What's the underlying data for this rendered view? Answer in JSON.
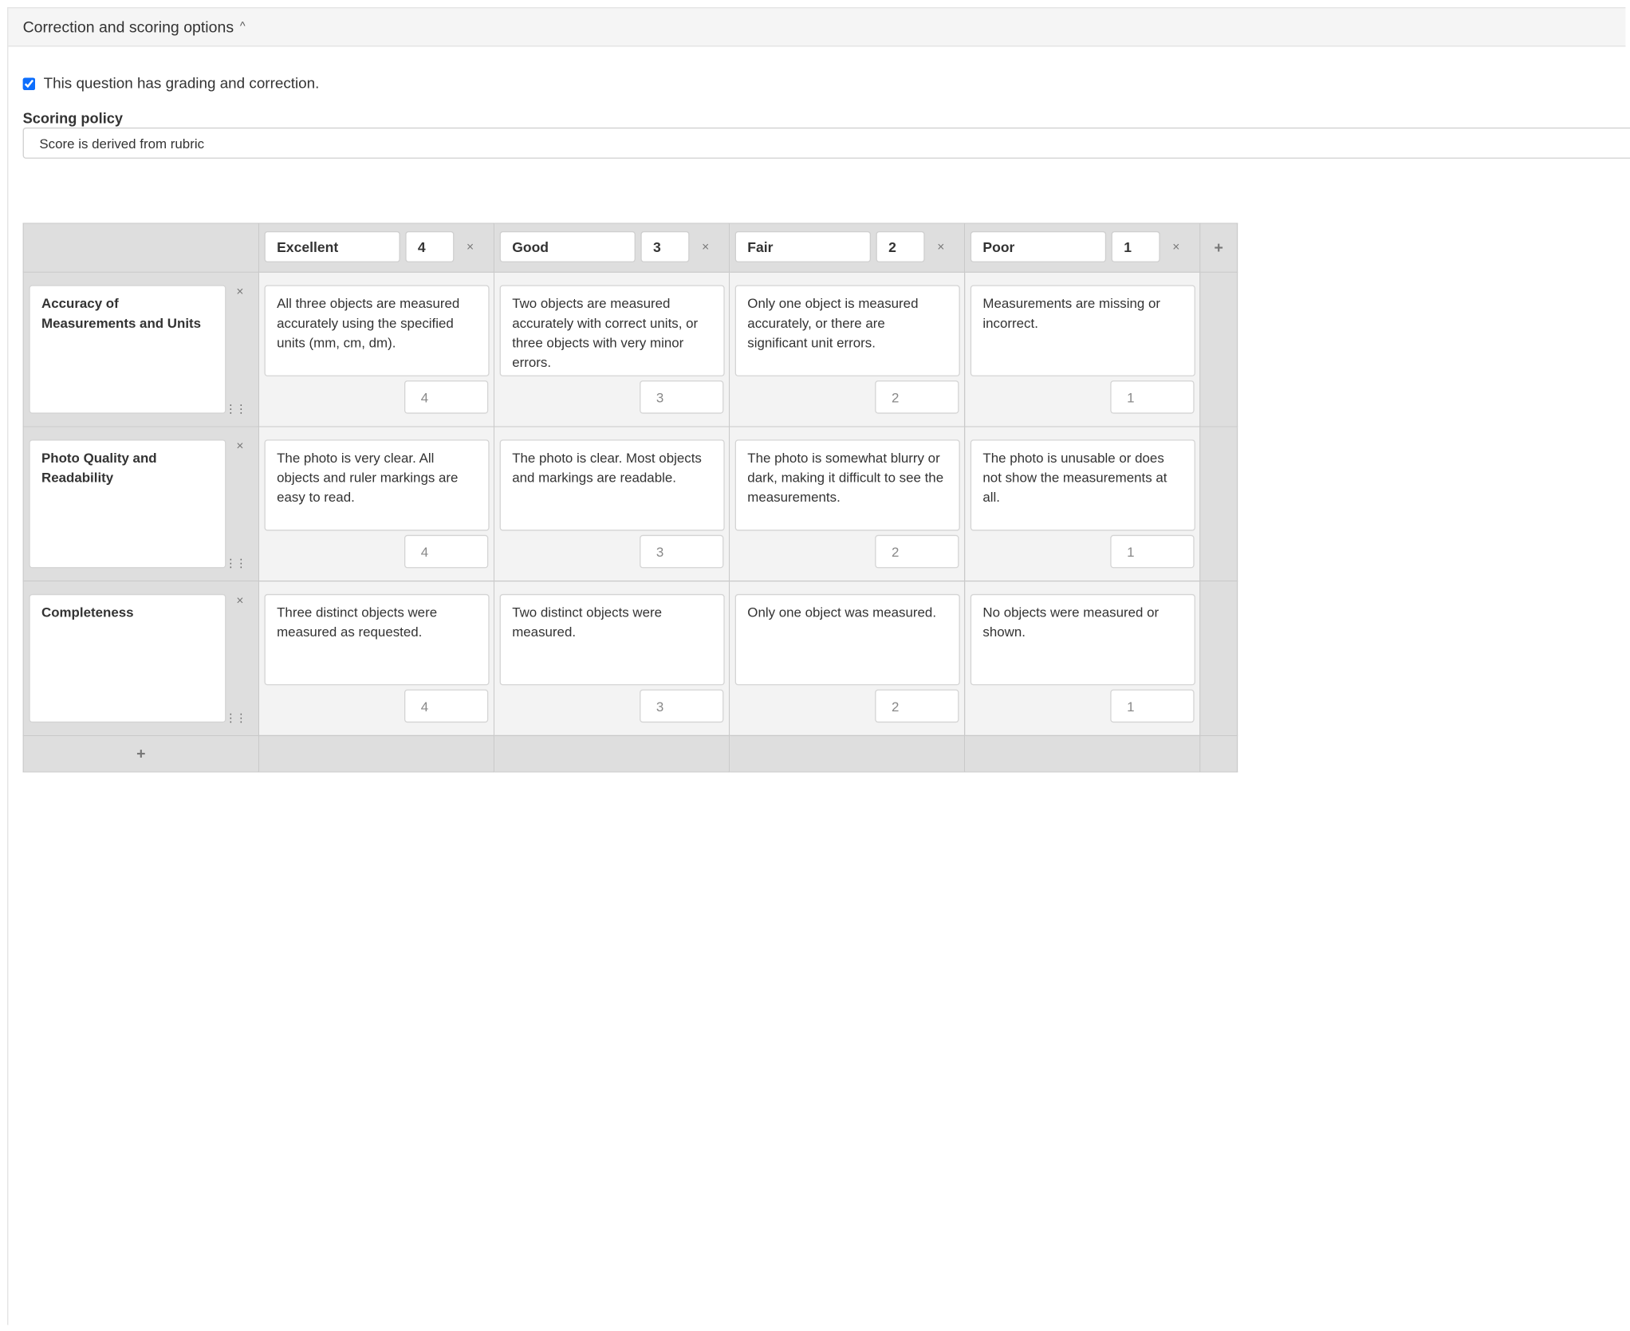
{
  "panel": {
    "title": "Correction and scoring options",
    "toggle_icon": "caret-up"
  },
  "grading": {
    "checkbox_label": "This question has grading and correction.",
    "checked": true
  },
  "scoring": {
    "label": "Scoring policy",
    "value": "Score is derived from rubric"
  },
  "rubric": {
    "levels": [
      {
        "name": "Excellent",
        "points": "4"
      },
      {
        "name": "Good",
        "points": "3"
      },
      {
        "name": "Fair",
        "points": "2"
      },
      {
        "name": "Poor",
        "points": "1"
      }
    ],
    "criteria": [
      {
        "name": "Accuracy of Measurements and Units",
        "cells": [
          {
            "text": "All three objects are measured accurately using the specified units (mm, cm, dm).",
            "points": "4"
          },
          {
            "text": "Two objects are measured accurately with correct units, or three objects with very minor errors.",
            "points": "3"
          },
          {
            "text": "Only one object is measured accurately, or there are significant unit errors.",
            "points": "2"
          },
          {
            "text": "Measurements are missing or incorrect.",
            "points": "1"
          }
        ]
      },
      {
        "name": "Photo Quality and Readability",
        "cells": [
          {
            "text": "The photo is very clear. All objects and ruler markings are easy to read.",
            "points": "4"
          },
          {
            "text": "The photo is clear. Most objects and markings are readable.",
            "points": "3"
          },
          {
            "text": "The photo is somewhat blurry or dark, making it difficult to see the measurements.",
            "points": "2"
          },
          {
            "text": "The photo is unusable or does not show the measurements at all.",
            "points": "1"
          }
        ]
      },
      {
        "name": "Completeness",
        "cells": [
          {
            "text": "Three distinct objects were measured as requested.",
            "points": "4"
          },
          {
            "text": "Two distinct objects were measured.",
            "points": "3"
          },
          {
            "text": "Only one object was measured.",
            "points": "2"
          },
          {
            "text": "No objects were measured or shown.",
            "points": "1"
          }
        ]
      }
    ],
    "icons": {
      "remove": "×",
      "add": "+",
      "drag": "⋮⋮"
    }
  }
}
